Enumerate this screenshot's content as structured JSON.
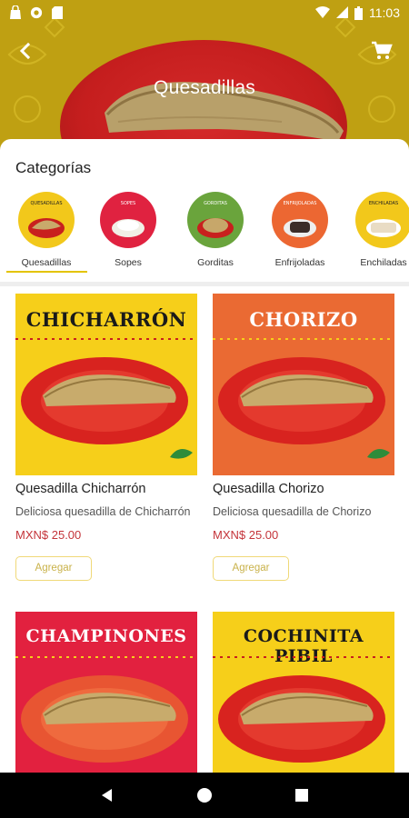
{
  "status_bar": {
    "time": "11:03"
  },
  "header": {
    "title": "Quesadillas"
  },
  "categories": {
    "title": "Categorías",
    "items": [
      {
        "label": "Quesadillas",
        "badge": "QUESADILLAS",
        "color": "#f2c81b",
        "selected": true
      },
      {
        "label": "Sopes",
        "badge": "SOPES",
        "color": "#e02240",
        "selected": false
      },
      {
        "label": "Gorditas",
        "badge": "GORDITAS",
        "color": "#6aa43c",
        "selected": false
      },
      {
        "label": "Enfrijoladas",
        "badge": "ENFRIJOLADAS",
        "color": "#ec6732",
        "selected": false
      },
      {
        "label": "Enchiladas",
        "badge": "ENCHILADAS",
        "color": "#f2c81b",
        "selected": false
      }
    ]
  },
  "products": [
    {
      "image_title": "CHICHARRÓN",
      "name": "Quesadilla Chicharrón",
      "description": "Deliciosa quesadilla de Chicharrón",
      "price": "MXN$ 25.00",
      "button": "Agregar",
      "bg": "#f6cf1a",
      "title_color": "#1a1a1a"
    },
    {
      "image_title": "CHORIZO",
      "name": "Quesadilla Chorizo",
      "description": "Deliciosa quesadilla de Chorizo",
      "price": "MXN$ 25.00",
      "button": "Agregar",
      "bg": "#ea6a33",
      "title_color": "#ffffff"
    },
    {
      "image_title": "CHAMPINONES",
      "name": "",
      "description": "",
      "price": "",
      "button": "",
      "bg": "#e2213f",
      "title_color": "#ffffff"
    },
    {
      "image_title": "COCHINITA PIBIL",
      "name": "",
      "description": "",
      "price": "",
      "button": "",
      "bg": "#f6cf1a",
      "title_color": "#1a1a1a"
    }
  ],
  "colors": {
    "accent": "#e3c400",
    "price": "#c4343a",
    "header_bg": "#bfa012"
  }
}
